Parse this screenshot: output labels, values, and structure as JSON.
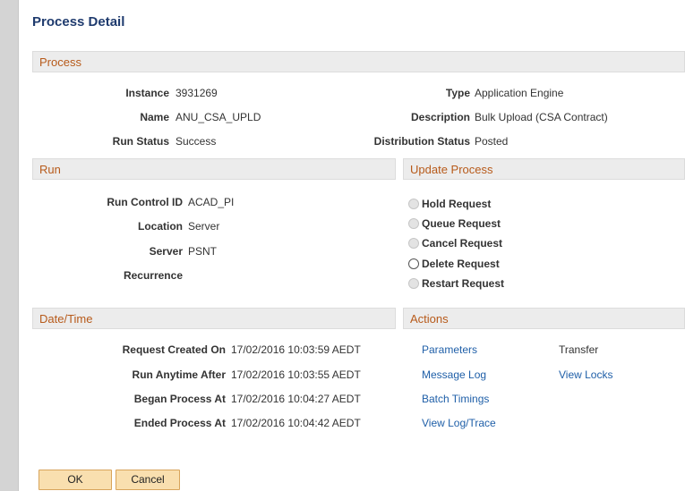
{
  "page_title": "Process Detail",
  "process": {
    "heading": "Process",
    "instance_label": "Instance",
    "instance_value": "3931269",
    "name_label": "Name",
    "name_value": "ANU_CSA_UPLD",
    "run_status_label": "Run Status",
    "run_status_value": "Success",
    "type_label": "Type",
    "type_value": "Application Engine",
    "description_label": "Description",
    "description_value": "Bulk Upload (CSA Contract)",
    "dist_status_label": "Distribution Status",
    "dist_status_value": "Posted"
  },
  "run": {
    "heading": "Run",
    "run_control_label": "Run Control ID",
    "run_control_value": "ACAD_PI",
    "location_label": "Location",
    "location_value": "Server",
    "server_label": "Server",
    "server_value": "PSNT",
    "recurrence_label": "Recurrence",
    "recurrence_value": ""
  },
  "update_process": {
    "heading": "Update Process",
    "options": [
      {
        "label": "Hold Request",
        "enabled": false
      },
      {
        "label": "Queue Request",
        "enabled": false
      },
      {
        "label": "Cancel Request",
        "enabled": false
      },
      {
        "label": "Delete Request",
        "enabled": true
      },
      {
        "label": "Restart Request",
        "enabled": false
      }
    ]
  },
  "datetime": {
    "heading": "Date/Time",
    "created_label": "Request Created On",
    "created_value": "17/02/2016 10:03:59 AEDT",
    "anytime_label": "Run Anytime After",
    "anytime_value": "17/02/2016 10:03:55 AEDT",
    "began_label": "Began Process At",
    "began_value": "17/02/2016 10:04:27 AEDT",
    "ended_label": "Ended Process At",
    "ended_value": "17/02/2016 10:04:42 AEDT"
  },
  "actions": {
    "heading": "Actions",
    "parameters": "Parameters",
    "transfer": "Transfer",
    "message_log": "Message Log",
    "view_locks": "View Locks",
    "batch_timings": "Batch Timings",
    "view_log_trace": "View Log/Trace"
  },
  "buttons": {
    "ok": "OK",
    "cancel": "Cancel"
  },
  "colors": {
    "section_heading_text": "#b75a1a",
    "link": "#1f5fa8",
    "title": "#1f3b6e",
    "button_bg": "#f9dfaf"
  }
}
